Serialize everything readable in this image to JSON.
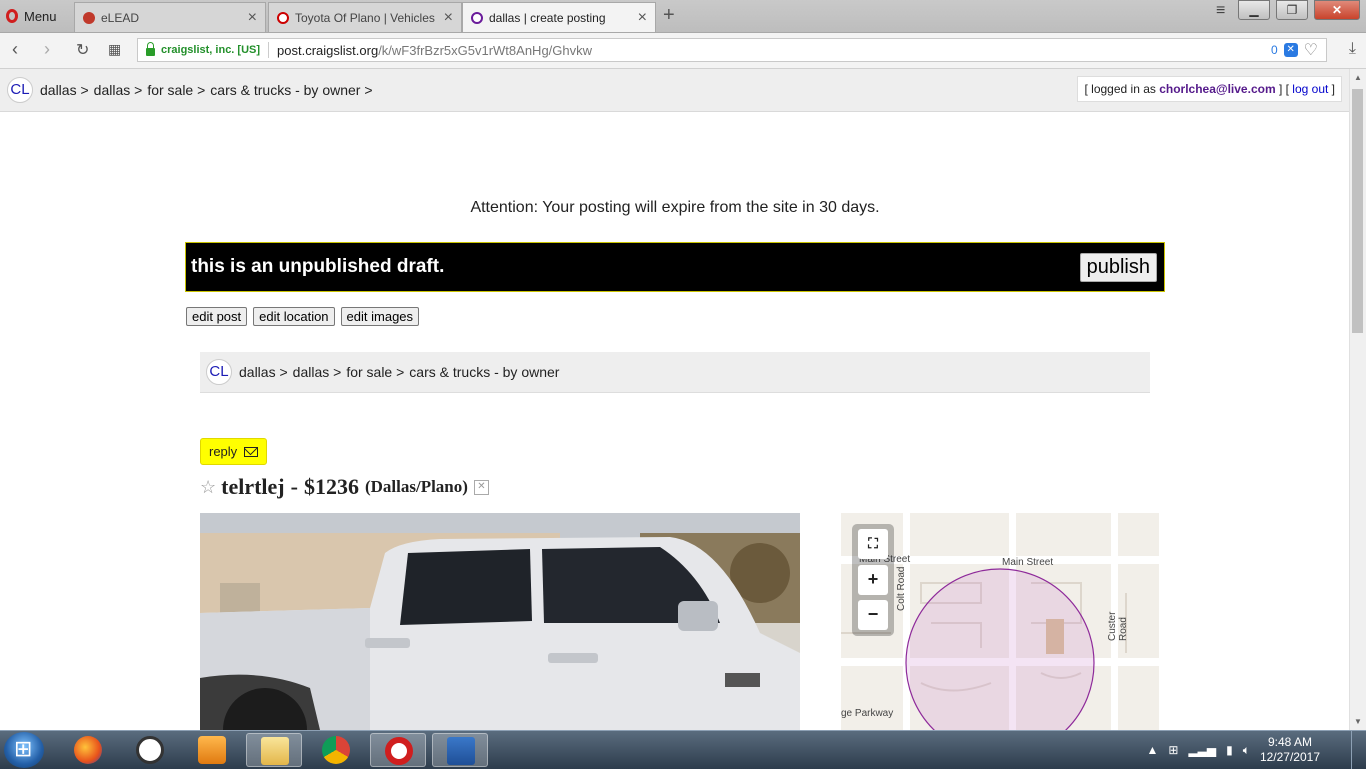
{
  "browser": {
    "menu_label": "Menu",
    "tabs": [
      {
        "title": "eLEAD",
        "color": "#c0392b"
      },
      {
        "title": "Toyota Of Plano | Vehicles",
        "color": "#cc0000"
      },
      {
        "title": "dallas | create posting",
        "color": "#6a1b9a"
      }
    ],
    "site_identity": "craigslist, inc. [US]",
    "url_host": "post.craigslist.org",
    "url_path": "/k/wF3frBzr5xG5v1rWt8AnHg/Ghvkw",
    "adblock_count": "0"
  },
  "header": {
    "logo": "CL",
    "crumbs": [
      "dallas >",
      "dallas >",
      "for sale >",
      "cars & trucks - by owner >"
    ],
    "login_prefix": "[ logged in as ",
    "login_email": "chorlchea@live.com",
    "login_mid": " ] [ ",
    "logout": "log out",
    "login_suffix": " ]"
  },
  "attention": "Attention: Your posting will expire from the site in 30 days.",
  "draft": {
    "message": "this is an unpublished draft.",
    "publish": "publish"
  },
  "edit_buttons": [
    "edit post",
    "edit location",
    "edit images"
  ],
  "inner_crumbs": {
    "logo": "CL",
    "items": [
      "dallas >",
      "dallas >",
      "for sale >",
      "cars & trucks - by owner"
    ]
  },
  "reply": "reply",
  "posting": {
    "title": "telrtlej",
    "dash": "-",
    "price": "$1236",
    "location": "(Dallas/Plano)"
  },
  "map": {
    "labels": [
      "Main Street",
      "Main Street",
      "Colt Road",
      "Custer Road",
      "ge Parkway"
    ],
    "zoom_in": "+",
    "zoom_out": "−"
  },
  "taskbar": {
    "time": "9:48 AM",
    "date": "12/27/2017"
  }
}
